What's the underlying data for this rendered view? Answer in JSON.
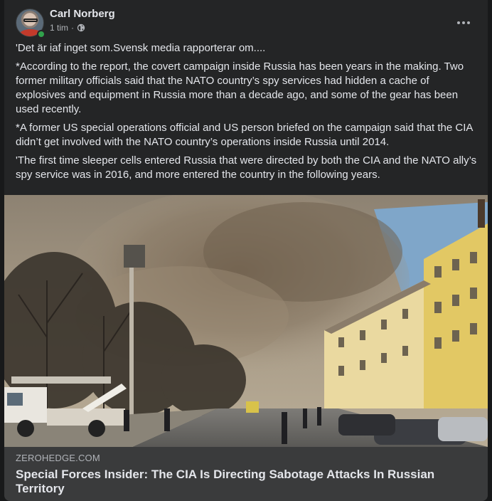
{
  "post": {
    "author": "Carl Norberg",
    "time": "1 tim",
    "separator": "·",
    "privacy_icon": "globe-icon",
    "more_icon": "more-options-icon",
    "paragraphs": [
      "'Det är iaf inget som.Svensk media rapporterar om....",
      "*According to the report, the covert campaign inside Russia has been years in the making. Two former military officials said that the NATO country’s spy services had hidden a cache of explosives and equipment in Russia more than a decade ago, and some of the gear has been used recently.",
      "*A former US special operations official and US person briefed on the campaign said that the CIA didn’t get involved with the NATO country’s operations inside Russia until 2014.",
      "'The first time sleeper cells entered Russia that were directed by both the CIA and the NATO ally’s spy service was in 2016, and more entered the country in the following years."
    ]
  },
  "link": {
    "domain": "ZEROHEDGE.COM",
    "title": "Special Forces Insider: The CIA Is Directing Sabotage Attacks In Russian Territory"
  },
  "colors": {
    "card_bg": "#242526",
    "preview_bg": "#3a3b3c",
    "online": "#31a24c",
    "building": "#e8d27a"
  }
}
